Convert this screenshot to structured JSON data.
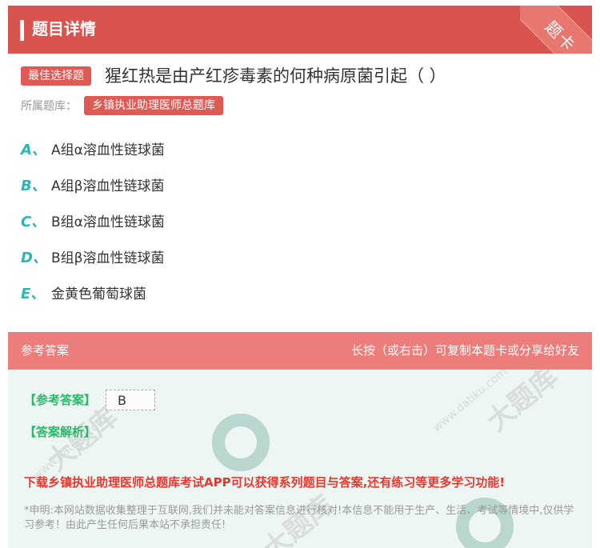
{
  "header": {
    "title": "题目详情",
    "corner_label": "题卡"
  },
  "question": {
    "type_tag": "最佳选择题",
    "text": "猩红热是由产红疹毒素的何种病原菌引起（ ）",
    "library_label": "所属题库：",
    "library_name": "乡镇执业助理医师总题库"
  },
  "options": [
    {
      "letter": "A、",
      "text": "A组α溶血性链球菌"
    },
    {
      "letter": "B、",
      "text": "A组β溶血性链球菌"
    },
    {
      "letter": "C、",
      "text": "B组α溶血性链球菌"
    },
    {
      "letter": "D、",
      "text": "B组β溶血性链球菌"
    },
    {
      "letter": "E、",
      "text": "金黄色葡萄球菌"
    }
  ],
  "answer_section": {
    "title": "参考答案",
    "hint": "长按（或右击）可复制本题卡或分享给好友",
    "answer_label": "【参考答案】",
    "answer_value": "B",
    "analysis_label": "【答案解析】",
    "promo": "下载乡镇执业助理医师总题库考试APP可以获得系列题目与答案,还有练习等更多学习功能!",
    "disclaimer": "*申明:本网站数据收集整理于互联网,我们并未能对答案信息进行核对!本信息不能用于生产、生活、考试等情境中,仅供学习参考！由此产生任何后果本站不承担责任!"
  },
  "watermarks": [
    "大题库",
    "www.datiku.com"
  ],
  "colors": {
    "header": "#d9534f",
    "accent_red": "#e05a55",
    "option_letter": "#2ab8b3",
    "answer_green": "#2db76a",
    "promo_red": "#e8382f"
  }
}
